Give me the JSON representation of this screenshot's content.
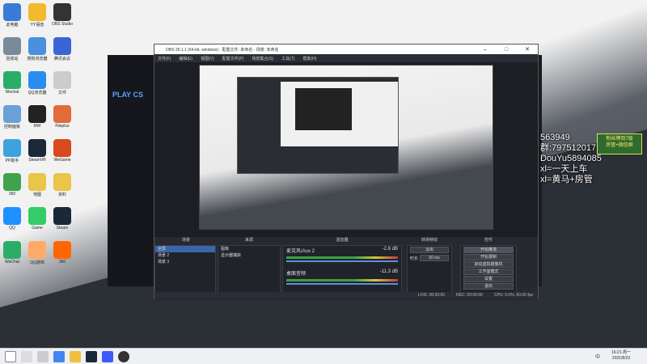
{
  "desktop": {
    "icons": [
      {
        "label": "此电脑",
        "color": "#3a7bd5"
      },
      {
        "label": "YY语音",
        "color": "#f2b92b"
      },
      {
        "label": "OBS Studio",
        "color": "#333333"
      },
      {
        "label": "回收站",
        "color": "#7a8a99"
      },
      {
        "label": "搜狗浏览器",
        "color": "#4a8fe0"
      },
      {
        "label": "腾讯会议",
        "color": "#3a66d5"
      },
      {
        "label": "Wechat",
        "color": "#2aae67"
      },
      {
        "label": "QQ浏览器",
        "color": "#2b8cf0"
      },
      {
        "label": "文件",
        "color": "#cccccc"
      },
      {
        "label": "控制面板",
        "color": "#6aa0d8"
      },
      {
        "label": "MW",
        "color": "#222222"
      },
      {
        "label": "Fileplus",
        "color": "#e26b3a"
      },
      {
        "label": "PP助手",
        "color": "#3ea2e0"
      },
      {
        "label": "SteamVR",
        "color": "#1b2838"
      },
      {
        "label": "WeGame",
        "color": "#d94a1e"
      },
      {
        "label": "360",
        "color": "#3fa34d"
      },
      {
        "label": "地图",
        "color": "#e9c54a"
      },
      {
        "label": "资料",
        "color": "#e9c54a"
      },
      {
        "label": "QQ",
        "color": "#1e90ff"
      },
      {
        "label": "Game",
        "color": "#3c6"
      },
      {
        "label": "Steam",
        "color": "#1b2838"
      },
      {
        "label": "WeChat",
        "color": "#2aae67"
      },
      {
        "label": "QQ游戏",
        "color": "#fa6"
      },
      {
        "label": "360",
        "color": "#f60"
      }
    ]
  },
  "obs": {
    "title": "OBS 26.1.1 (64-bit, windows) - 配置文件: 未命名 - 场景: 未命名",
    "menu": [
      "文件(F)",
      "编辑(E)",
      "视图(V)",
      "配置文件(P)",
      "场景集合(S)",
      "工具(T)",
      "帮助(H)"
    ],
    "dock_titles": {
      "scenes": "场景",
      "sources": "来源",
      "mixer": "混音器",
      "transitions": "转场特效",
      "controls": "控件"
    },
    "scenes": [
      "全屏",
      "场景 2",
      "场景 3"
    ],
    "sources": [
      "图像",
      "显示器捕获"
    ],
    "mixer": [
      {
        "name": "麦克风/Aux 2",
        "db": "-2.8 dB"
      },
      {
        "name": "桌面音频",
        "db": "-11.3 dB"
      }
    ],
    "transition": {
      "type": "淡出",
      "duration_label": "时长",
      "duration": "50 ms"
    },
    "controls": [
      "开始推流",
      "开始录制",
      "启动虚拟摄像机",
      "工作室模式",
      "设置",
      "退出"
    ],
    "status": {
      "live": "LIVE: 00:00:00",
      "rec": "REC: 00:00:00",
      "cpu": "CPU: 0.0%, 60.00 fps"
    }
  },
  "overlay": {
    "lines": [
      "563949",
      "群:797512017",
      "DouYu5894085",
      "xl=一天上车",
      "xl=黄马+房管"
    ],
    "badge_line1": "粉丝牌到7级",
    "badge_line2": "房管+微信群"
  },
  "taskbar": {
    "time": "16:21 周一",
    "date": "2021/8/23",
    "tray_text": "中"
  }
}
